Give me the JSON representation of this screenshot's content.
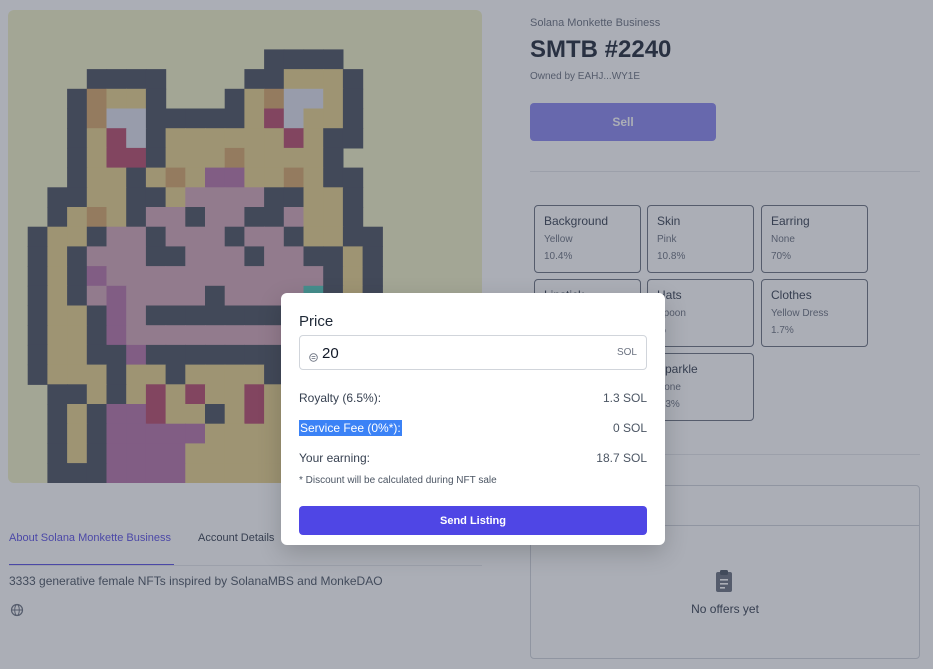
{
  "nft": {
    "collection": "Solana Monkette Business",
    "title": "SMTB #2240",
    "owner": "Owned by EAHJ...WY1E"
  },
  "sell_button": "Sell",
  "attributes": [
    {
      "type": "Background",
      "value": "Yellow",
      "rarity": "10.4%"
    },
    {
      "type": "Skin",
      "value": "Pink",
      "rarity": "10.8%"
    },
    {
      "type": "Earring",
      "value": "None",
      "rarity": "70%"
    },
    {
      "type": "Lipstick",
      "value": "",
      "rarity": ""
    },
    {
      "type": "Hats",
      "value": "Spoon",
      "rarity": "%"
    },
    {
      "type": "Clothes",
      "value": "Yellow Dress",
      "rarity": "1.7%"
    },
    {
      "type": "Sparkle",
      "value": "None",
      "rarity": "4.3%"
    }
  ],
  "tabs": [
    "About Solana Monkette Business",
    "Account Details"
  ],
  "description": "3333 generative female NFTs inspired by SolanaMBS and MonkeDAO",
  "offers": {
    "empty_text": "No offers yet"
  },
  "modal": {
    "price_label": "Price",
    "price_value": "20",
    "price_unit": "SOL",
    "royalty_label": "Royalty (6.5%):",
    "royalty_value": "1.3 SOL",
    "fee_label": "Service Fee (0%*):",
    "fee_value": "0 SOL",
    "earning_label": "Your earning:",
    "earning_value": "18.7 SOL",
    "note": "* Discount will be calculated during NFT sale",
    "submit_label": "Send Listing"
  },
  "colors": {
    "accent": "#4f46e5",
    "nft_background": "#f2f1c7"
  },
  "icons": [
    "globe-icon",
    "clipboard-icon",
    "sol-icon"
  ]
}
